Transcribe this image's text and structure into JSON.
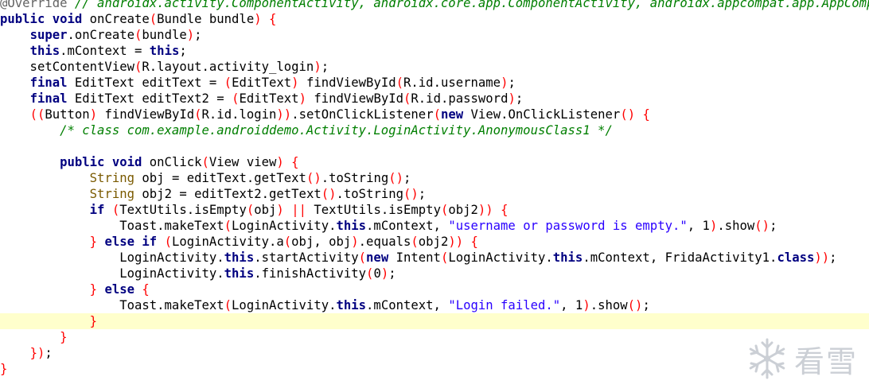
{
  "editor": {
    "current_line_index": 20,
    "lines": [
      [
        {
          "t": "@Override",
          "c": "ann"
        },
        {
          "t": " // androidx.activity.ComponentActivity, androidx.core.app.ComponentActivity, androidx.appcompat.app.AppCompatActivity",
          "c": "cm"
        }
      ],
      [
        {
          "t": "public void",
          "c": "kw"
        },
        {
          "t": " onCreate",
          "c": "pl"
        },
        {
          "t": "(",
          "c": "br"
        },
        {
          "t": "Bundle bundle",
          "c": "pl"
        },
        {
          "t": ")",
          "c": "br"
        },
        {
          "t": " ",
          "c": "pl"
        },
        {
          "t": "{",
          "c": "br"
        }
      ],
      [
        {
          "t": "    ",
          "c": "pl"
        },
        {
          "t": "super",
          "c": "kw"
        },
        {
          "t": ".onCreate",
          "c": "pl"
        },
        {
          "t": "(",
          "c": "br"
        },
        {
          "t": "bundle",
          "c": "pl"
        },
        {
          "t": ")",
          "c": "br"
        },
        {
          "t": ";",
          "c": "pl"
        }
      ],
      [
        {
          "t": "    ",
          "c": "pl"
        },
        {
          "t": "this",
          "c": "kw"
        },
        {
          "t": ".mContext = ",
          "c": "pl"
        },
        {
          "t": "this",
          "c": "kw"
        },
        {
          "t": ";",
          "c": "pl"
        }
      ],
      [
        {
          "t": "    setContentView",
          "c": "pl"
        },
        {
          "t": "(",
          "c": "br"
        },
        {
          "t": "R.layout.activity_login",
          "c": "pl"
        },
        {
          "t": ")",
          "c": "br"
        },
        {
          "t": ";",
          "c": "pl"
        }
      ],
      [
        {
          "t": "    ",
          "c": "pl"
        },
        {
          "t": "final",
          "c": "kw"
        },
        {
          "t": " EditText editText = ",
          "c": "pl"
        },
        {
          "t": "(",
          "c": "br"
        },
        {
          "t": "EditText",
          "c": "pl"
        },
        {
          "t": ")",
          "c": "br"
        },
        {
          "t": " findViewById",
          "c": "pl"
        },
        {
          "t": "(",
          "c": "br"
        },
        {
          "t": "R.id.username",
          "c": "pl"
        },
        {
          "t": ")",
          "c": "br"
        },
        {
          "t": ";",
          "c": "pl"
        }
      ],
      [
        {
          "t": "    ",
          "c": "pl"
        },
        {
          "t": "final",
          "c": "kw"
        },
        {
          "t": " EditText editText2 = ",
          "c": "pl"
        },
        {
          "t": "(",
          "c": "br"
        },
        {
          "t": "EditText",
          "c": "pl"
        },
        {
          "t": ")",
          "c": "br"
        },
        {
          "t": " findViewById",
          "c": "pl"
        },
        {
          "t": "(",
          "c": "br"
        },
        {
          "t": "R.id.password",
          "c": "pl"
        },
        {
          "t": ")",
          "c": "br"
        },
        {
          "t": ";",
          "c": "pl"
        }
      ],
      [
        {
          "t": "    ",
          "c": "pl"
        },
        {
          "t": "((",
          "c": "br"
        },
        {
          "t": "Button",
          "c": "pl"
        },
        {
          "t": ")",
          "c": "br"
        },
        {
          "t": " findViewById",
          "c": "pl"
        },
        {
          "t": "(",
          "c": "br"
        },
        {
          "t": "R.id.login",
          "c": "pl"
        },
        {
          "t": "))",
          "c": "br"
        },
        {
          "t": ".setOnClickListener",
          "c": "pl"
        },
        {
          "t": "(",
          "c": "br"
        },
        {
          "t": "new",
          "c": "kw"
        },
        {
          "t": " View.OnClickListener",
          "c": "pl"
        },
        {
          "t": "()",
          "c": "br"
        },
        {
          "t": " ",
          "c": "pl"
        },
        {
          "t": "{",
          "c": "br"
        }
      ],
      [
        {
          "t": "        ",
          "c": "pl"
        },
        {
          "t": "/* class com.example.androiddemo.Activity.LoginActivity.AnonymousClass1 */",
          "c": "cm"
        }
      ],
      [
        {
          "t": "",
          "c": "pl"
        }
      ],
      [
        {
          "t": "        ",
          "c": "pl"
        },
        {
          "t": "public void",
          "c": "kw"
        },
        {
          "t": " onClick",
          "c": "pl"
        },
        {
          "t": "(",
          "c": "br"
        },
        {
          "t": "View view",
          "c": "pl"
        },
        {
          "t": ")",
          "c": "br"
        },
        {
          "t": " ",
          "c": "pl"
        },
        {
          "t": "{",
          "c": "br"
        }
      ],
      [
        {
          "t": "            ",
          "c": "pl"
        },
        {
          "t": "String",
          "c": "type"
        },
        {
          "t": " obj = editText.getText",
          "c": "pl"
        },
        {
          "t": "()",
          "c": "br"
        },
        {
          "t": ".toString",
          "c": "pl"
        },
        {
          "t": "()",
          "c": "br"
        },
        {
          "t": ";",
          "c": "pl"
        }
      ],
      [
        {
          "t": "            ",
          "c": "pl"
        },
        {
          "t": "String",
          "c": "type"
        },
        {
          "t": " obj2 = editText2.getText",
          "c": "pl"
        },
        {
          "t": "()",
          "c": "br"
        },
        {
          "t": ".toString",
          "c": "pl"
        },
        {
          "t": "()",
          "c": "br"
        },
        {
          "t": ";",
          "c": "pl"
        }
      ],
      [
        {
          "t": "            ",
          "c": "pl"
        },
        {
          "t": "if",
          "c": "kw"
        },
        {
          "t": " ",
          "c": "pl"
        },
        {
          "t": "(",
          "c": "br"
        },
        {
          "t": "TextUtils.isEmpty",
          "c": "pl"
        },
        {
          "t": "(",
          "c": "br"
        },
        {
          "t": "obj",
          "c": "pl"
        },
        {
          "t": ")",
          "c": "br"
        },
        {
          "t": " ",
          "c": "pl"
        },
        {
          "t": "||",
          "c": "br"
        },
        {
          "t": " TextUtils.isEmpty",
          "c": "pl"
        },
        {
          "t": "(",
          "c": "br"
        },
        {
          "t": "obj2",
          "c": "pl"
        },
        {
          "t": "))",
          "c": "br"
        },
        {
          "t": " ",
          "c": "pl"
        },
        {
          "t": "{",
          "c": "br"
        }
      ],
      [
        {
          "t": "                Toast.makeText",
          "c": "pl"
        },
        {
          "t": "(",
          "c": "br"
        },
        {
          "t": "LoginActivity.",
          "c": "pl"
        },
        {
          "t": "this",
          "c": "kw"
        },
        {
          "t": ".mContext, ",
          "c": "pl"
        },
        {
          "t": "\"username or password is empty.\"",
          "c": "str"
        },
        {
          "t": ", 1",
          "c": "pl"
        },
        {
          "t": ")",
          "c": "br"
        },
        {
          "t": ".show",
          "c": "pl"
        },
        {
          "t": "()",
          "c": "br"
        },
        {
          "t": ";",
          "c": "pl"
        }
      ],
      [
        {
          "t": "            ",
          "c": "pl"
        },
        {
          "t": "}",
          "c": "br"
        },
        {
          "t": " ",
          "c": "pl"
        },
        {
          "t": "else if",
          "c": "kw"
        },
        {
          "t": " ",
          "c": "pl"
        },
        {
          "t": "(",
          "c": "br"
        },
        {
          "t": "LoginActivity.a",
          "c": "pl"
        },
        {
          "t": "(",
          "c": "br"
        },
        {
          "t": "obj, obj",
          "c": "pl"
        },
        {
          "t": ")",
          "c": "br"
        },
        {
          "t": ".equals",
          "c": "pl"
        },
        {
          "t": "(",
          "c": "br"
        },
        {
          "t": "obj2",
          "c": "pl"
        },
        {
          "t": "))",
          "c": "br"
        },
        {
          "t": " ",
          "c": "pl"
        },
        {
          "t": "{",
          "c": "br"
        }
      ],
      [
        {
          "t": "                LoginActivity.",
          "c": "pl"
        },
        {
          "t": "this",
          "c": "kw"
        },
        {
          "t": ".startActivity",
          "c": "pl"
        },
        {
          "t": "(",
          "c": "br"
        },
        {
          "t": "new",
          "c": "kw"
        },
        {
          "t": " Intent",
          "c": "pl"
        },
        {
          "t": "(",
          "c": "br"
        },
        {
          "t": "LoginActivity.",
          "c": "pl"
        },
        {
          "t": "this",
          "c": "kw"
        },
        {
          "t": ".mContext, FridaActivity1.",
          "c": "pl"
        },
        {
          "t": "class",
          "c": "kw"
        },
        {
          "t": "))",
          "c": "br"
        },
        {
          "t": ";",
          "c": "pl"
        }
      ],
      [
        {
          "t": "                LoginActivity.",
          "c": "pl"
        },
        {
          "t": "this",
          "c": "kw"
        },
        {
          "t": ".finishActivity",
          "c": "pl"
        },
        {
          "t": "(",
          "c": "br"
        },
        {
          "t": "0",
          "c": "num"
        },
        {
          "t": ")",
          "c": "br"
        },
        {
          "t": ";",
          "c": "pl"
        }
      ],
      [
        {
          "t": "            ",
          "c": "pl"
        },
        {
          "t": "}",
          "c": "br"
        },
        {
          "t": " ",
          "c": "pl"
        },
        {
          "t": "else",
          "c": "kw"
        },
        {
          "t": " ",
          "c": "pl"
        },
        {
          "t": "{",
          "c": "br"
        }
      ],
      [
        {
          "t": "                Toast.makeText",
          "c": "pl"
        },
        {
          "t": "(",
          "c": "br"
        },
        {
          "t": "LoginActivity.",
          "c": "pl"
        },
        {
          "t": "this",
          "c": "kw"
        },
        {
          "t": ".mContext, ",
          "c": "pl"
        },
        {
          "t": "\"Login failed.\"",
          "c": "str"
        },
        {
          "t": ", 1",
          "c": "pl"
        },
        {
          "t": ")",
          "c": "br"
        },
        {
          "t": ".show",
          "c": "pl"
        },
        {
          "t": "()",
          "c": "br"
        },
        {
          "t": ";",
          "c": "pl"
        }
      ],
      [
        {
          "t": "            ",
          "c": "pl"
        },
        {
          "t": "}",
          "c": "br"
        }
      ],
      [
        {
          "t": "        ",
          "c": "pl"
        },
        {
          "t": "}",
          "c": "br"
        }
      ],
      [
        {
          "t": "    ",
          "c": "pl"
        },
        {
          "t": "})",
          "c": "br"
        },
        {
          "t": ";",
          "c": "pl"
        }
      ],
      [
        {
          "t": "}",
          "c": "br"
        }
      ]
    ]
  },
  "watermark": {
    "text": "看雪",
    "icon": "snowflake-logo-icon"
  }
}
